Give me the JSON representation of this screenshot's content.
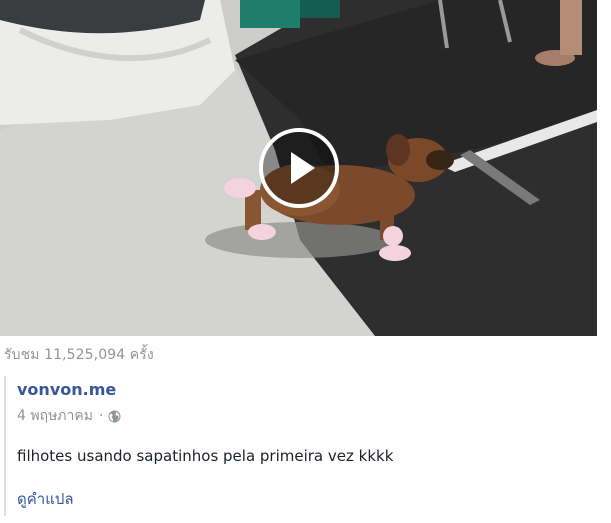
{
  "video": {
    "play_icon": "play-icon",
    "overlay_color": "#ffffff"
  },
  "views_text": "รับชม 11,525,094 ครั้ง",
  "post": {
    "author": "vonvon.me",
    "date": "4 พฤษภาคม",
    "separator": "·",
    "privacy_icon": "globe-icon",
    "text": "filhotes usando sapatinhos pela primeira vez kkkk",
    "translate_label": "ดูคำแปล"
  },
  "colors": {
    "link": "#365899",
    "muted": "#90949c",
    "text": "#1d2129"
  }
}
